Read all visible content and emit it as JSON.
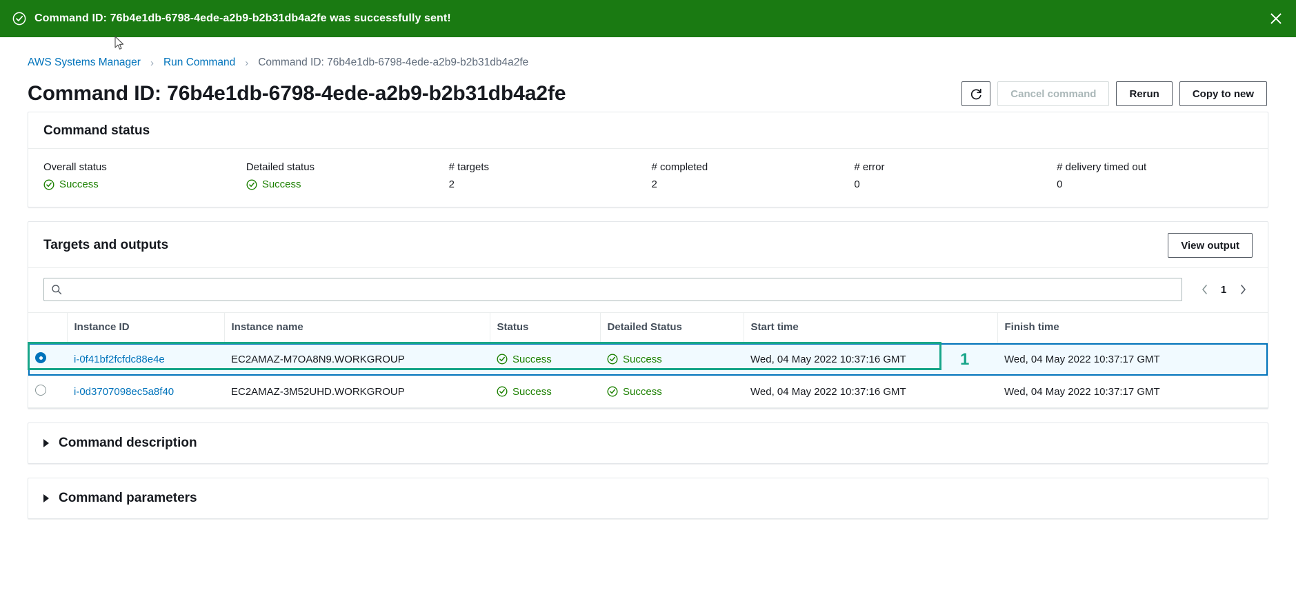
{
  "flash": {
    "icon": "check-circle-icon",
    "message": "Command ID: 76b4e1db-6798-4ede-a2b9-b2b31db4a2fe was successfully sent!",
    "close_label": "close-icon",
    "background_color": "#1a7a12"
  },
  "breadcrumb": {
    "items": [
      {
        "label": "AWS Systems Manager",
        "current": false
      },
      {
        "label": "Run Command",
        "current": false
      },
      {
        "label": "Command ID: 76b4e1db-6798-4ede-a2b9-b2b31db4a2fe",
        "current": true
      }
    ],
    "separator": "›"
  },
  "header": {
    "title": "Command ID: 76b4e1db-6798-4ede-a2b9-b2b31db4a2fe",
    "actions": {
      "refresh_icon": "refresh-icon",
      "cancel_label": "Cancel command",
      "rerun_label": "Rerun",
      "copy_label": "Copy to new"
    }
  },
  "command_status": {
    "title": "Command status",
    "fields": [
      {
        "label": "Overall status",
        "value": "Success",
        "status": true
      },
      {
        "label": "Detailed status",
        "value": "Success",
        "status": true
      },
      {
        "label": "# targets",
        "value": "2",
        "status": false
      },
      {
        "label": "# completed",
        "value": "2",
        "status": false
      },
      {
        "label": "# error",
        "value": "0",
        "status": false
      },
      {
        "label": "# delivery timed out",
        "value": "0",
        "status": false
      }
    ]
  },
  "targets": {
    "title": "Targets and outputs",
    "view_output_label": "View output",
    "search": {
      "placeholder": "",
      "value": "",
      "icon": "search-icon"
    },
    "pagination": {
      "page": "1",
      "prev_icon": "chevron-left-icon",
      "next_icon": "chevron-right-icon"
    },
    "columns": [
      "Instance ID",
      "Instance name",
      "Status",
      "Detailed Status",
      "Start time",
      "Finish time"
    ],
    "rows": [
      {
        "selected": true,
        "instance_id": "i-0f41bf2fcfdc88e4e",
        "instance_name": "EC2AMAZ-M7OA8N9.WORKGROUP",
        "status": "Success",
        "detailed_status": "Success",
        "start_time": "Wed, 04 May 2022 10:37:16 GMT",
        "finish_time": "Wed, 04 May 2022 10:37:17 GMT"
      },
      {
        "selected": false,
        "instance_id": "i-0d3707098ec5a8f40",
        "instance_name": "EC2AMAZ-3M52UHD.WORKGROUP",
        "status": "Success",
        "detailed_status": "Success",
        "start_time": "Wed, 04 May 2022 10:37:16 GMT",
        "finish_time": "Wed, 04 May 2022 10:37:17 GMT"
      }
    ]
  },
  "annotation": {
    "number": "1",
    "color": "#17a589"
  },
  "sections": [
    {
      "title": "Command description",
      "expanded": false
    },
    {
      "title": "Command parameters",
      "expanded": false
    }
  ],
  "colors": {
    "success_green": "#1d8102",
    "link_blue": "#0073bb",
    "banner_green": "#1a7a12",
    "annotation_teal": "#17a589"
  }
}
